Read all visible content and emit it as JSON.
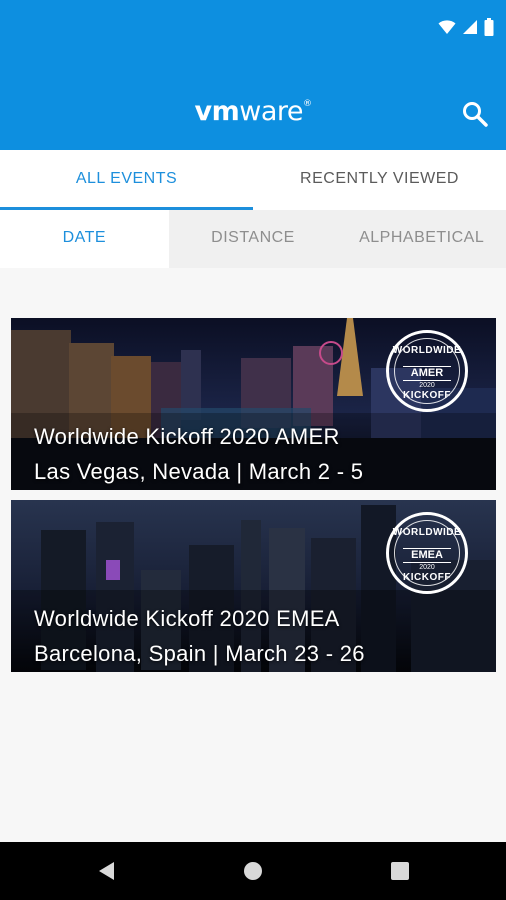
{
  "status_bar": {
    "icons": [
      "wifi-icon",
      "signal-icon",
      "battery-icon"
    ]
  },
  "header": {
    "brand_bold": "vm",
    "brand_regular": "ware",
    "brand_mark": "®",
    "search_icon": "search-icon"
  },
  "tabs": [
    {
      "label": "ALL EVENTS",
      "active": true
    },
    {
      "label": "RECENTLY VIEWED",
      "active": false
    }
  ],
  "sort_tabs": [
    {
      "label": "DATE",
      "active": true
    },
    {
      "label": "DISTANCE",
      "active": false
    },
    {
      "label": "ALPHABETICAL",
      "active": false
    }
  ],
  "events": [
    {
      "title": "Worldwide Kickoff 2020 AMER",
      "subtitle": "Las Vegas, Nevada | March 2 - 5",
      "badge": {
        "top": "WORLDWIDE",
        "region": "AMER",
        "year": "2020",
        "bottom": "KICKOFF"
      }
    },
    {
      "title": "Worldwide Kickoff 2020 EMEA",
      "subtitle": "Barcelona, Spain | March 23 - 26",
      "badge": {
        "top": "WORLDWIDE",
        "region": "EMEA",
        "year": "2020",
        "bottom": "KICKOFF"
      }
    }
  ],
  "nav_bar": {
    "icons": [
      "back-icon",
      "home-icon",
      "recents-icon"
    ]
  },
  "colors": {
    "header": "#0d8fe0",
    "accent": "#1d8fdc",
    "nav": "#000000"
  }
}
